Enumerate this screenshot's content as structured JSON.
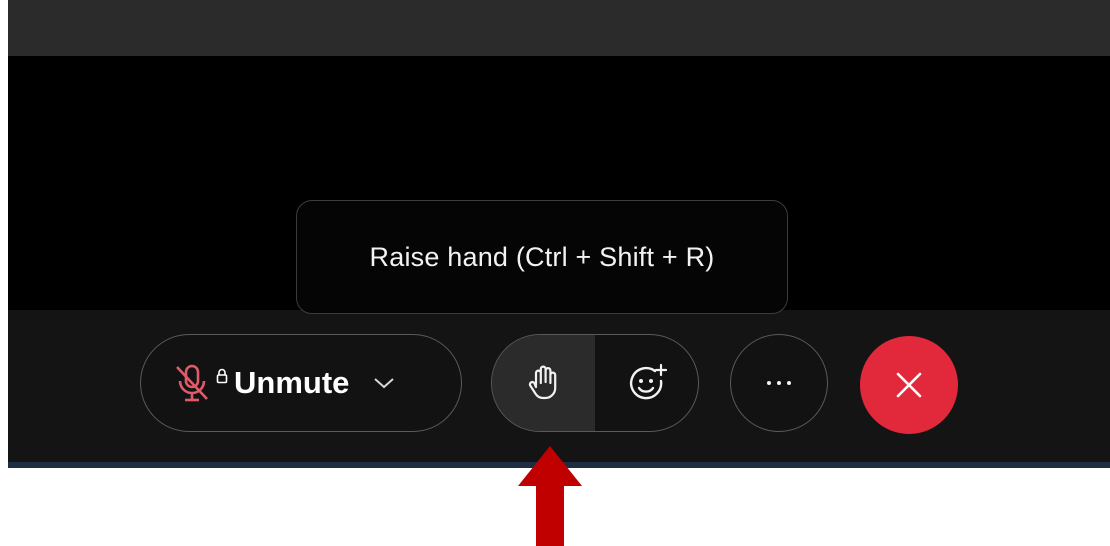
{
  "tooltip": {
    "text": "Raise hand (Ctrl + Shift + R)"
  },
  "toolbar": {
    "unmute_label": "Unmute",
    "mic_icon": "microphone-muted-icon",
    "lock_icon": "lock-icon",
    "dropdown_icon": "chevron-down-icon",
    "raise_hand_icon": "hand-icon",
    "reactions_icon": "emoji-add-icon",
    "more_icon": "ellipsis-icon",
    "end_icon": "close-icon"
  },
  "annotation": {
    "arrow_icon": "arrow-up-icon",
    "arrow_color": "#c00000"
  },
  "colors": {
    "end_call": "#e2293c",
    "muted_mic": "#e05a6a",
    "tooltip_bg": "#050505",
    "toolbar_bg": "#141414"
  }
}
